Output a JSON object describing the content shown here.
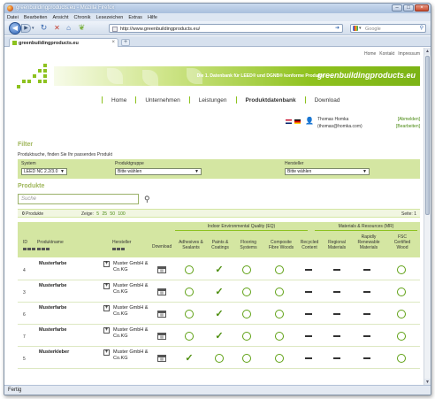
{
  "window": {
    "title": "greenbuildingproducts.eu - Mozilla Firefox"
  },
  "menu": [
    "Datei",
    "Bearbeiten",
    "Ansicht",
    "Chronik",
    "Lesezeichen",
    "Extras",
    "Hilfe"
  ],
  "nav": {
    "url": "http://www.greenbuildingproducts.eu/",
    "search_placeholder": "Google"
  },
  "tab": {
    "label": "greenbuildingproducts.eu"
  },
  "status": "Fertig",
  "site": {
    "top_links": [
      "Home",
      "Kontakt",
      "Impressum"
    ],
    "tagline": "Die 1. Datenbank für LEED® und DGNB® konforme Produkte",
    "brand": "greenbuildingproducts.eu",
    "main_nav": [
      "Home",
      "Unternehmen",
      "Leistungen",
      "Produktdatenbank",
      "Download"
    ],
    "user": {
      "name": "Thomas Homka",
      "email": "(thomas@homka.com)",
      "logout": "[Abmelden]",
      "edit": "[Bearbeiten]"
    }
  },
  "filter": {
    "title": "Filter",
    "hint": "Produktsuche, finden Sie Ihr passendes Produkt",
    "system_label": "System",
    "system_value": "LEED NC 2.2/3.0",
    "group_label": "Produktgruppe",
    "group_value": "Bitte wählen",
    "maker_label": "Hersteller",
    "maker_value": "Bitte wählen"
  },
  "products": {
    "title": "Produkte",
    "search_placeholder": "Suche",
    "count_value": "0",
    "count_label": "Produkte",
    "show_label": "Zeige:",
    "per_page": [
      "5",
      "25",
      "50",
      "100"
    ],
    "page_label": "Seite: 1"
  },
  "table": {
    "group_eq": "Indoor Environmental Quality (EQ)",
    "group_mr": "Materials & Resources (MR)",
    "col_id": "ID",
    "col_name": "Produktname",
    "col_maker": "Hersteller",
    "col_download": "Download",
    "criteria": [
      "Adhesives & Sealants",
      "Paints & Coatings",
      "Flooring Systems",
      "Composite Fibre Woods",
      "Recycled Content",
      "Regional Materials",
      "Rapidly Renewable Materials",
      "FSC Certified Wood"
    ],
    "rows": [
      {
        "id": "4",
        "name": "Musterfarbe",
        "maker": "Muster GmbH & Co.KG",
        "marks": [
          "circle",
          "check",
          "circle",
          "circle",
          "dash",
          "dash",
          "dash",
          "circle"
        ]
      },
      {
        "id": "3",
        "name": "Musterfarbe",
        "maker": "Muster GmbH & Co.KG",
        "marks": [
          "circle",
          "check",
          "circle",
          "circle",
          "dash",
          "dash",
          "dash",
          "circle"
        ]
      },
      {
        "id": "6",
        "name": "Musterfarbe",
        "maker": "Muster GmbH & Co.KG",
        "marks": [
          "circle",
          "check",
          "circle",
          "circle",
          "dash",
          "dash",
          "dash",
          "circle"
        ]
      },
      {
        "id": "7",
        "name": "Musterfarbe",
        "maker": "Muster GmbH & Co.KG",
        "marks": [
          "circle",
          "check",
          "circle",
          "circle",
          "dash",
          "dash",
          "dash",
          "circle"
        ]
      },
      {
        "id": "5",
        "name": "Musterkleber",
        "maker": "Muster GmbH & Co.KG",
        "marks": [
          "check",
          "circle",
          "circle",
          "circle",
          "dash",
          "dash",
          "dash",
          "circle"
        ]
      }
    ]
  },
  "colors": {
    "brand_green": "#8dc21f",
    "filter_bg": "#d4e6a2",
    "mark_green": "#5fa114"
  }
}
